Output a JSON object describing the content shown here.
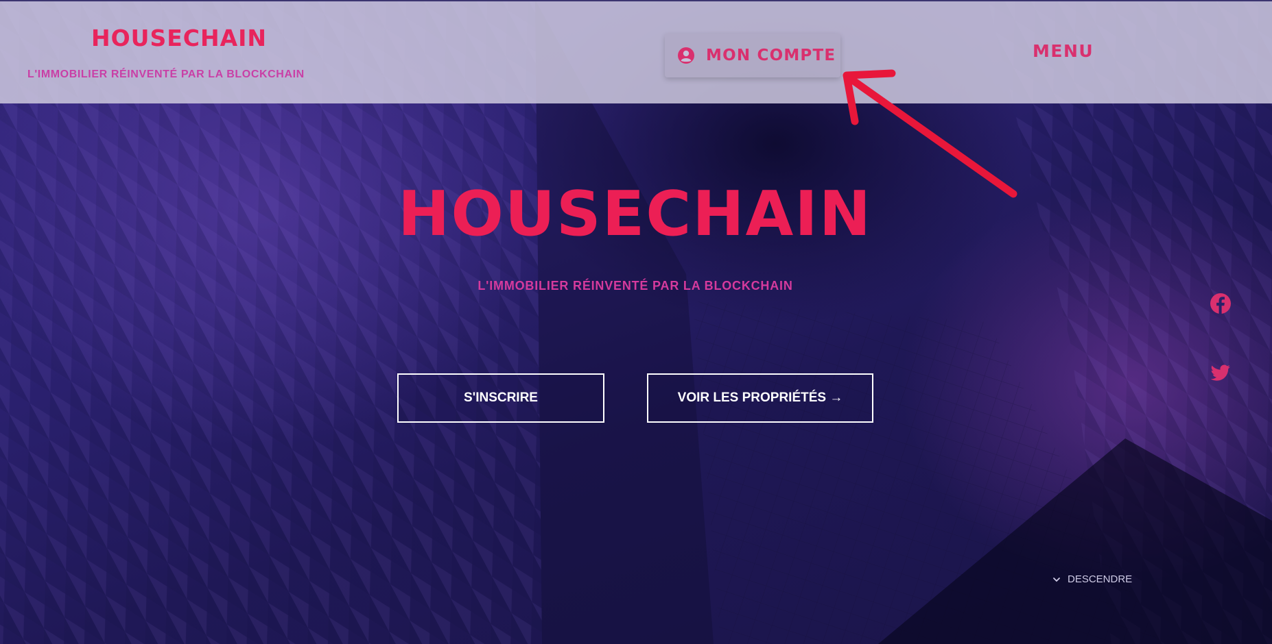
{
  "header": {
    "brand": "HOUSECHAIN",
    "tagline": "L'IMMOBILIER RÉINVENTÉ PAR LA BLOCKCHAIN",
    "account_label": "MON COMPTE",
    "menu_label": "MENU"
  },
  "hero": {
    "brand": "HOUSECHAIN",
    "tagline": "L'IMMOBILIER RÉINVENTÉ PAR LA BLOCKCHAIN",
    "signup_label": "S'INSCRIRE",
    "properties_label": "VOIR LES PROPRIÉTÉS →",
    "scroll_label": "DESCENDRE"
  },
  "social": {
    "icons": [
      "facebook-icon",
      "twitter-icon"
    ]
  },
  "colors": {
    "brand": "#ec1f55",
    "tagline": "#d63a9d",
    "header_bg": "#cdc8de",
    "hero_bg": "#2b2170",
    "annotation": "#e8173a"
  }
}
